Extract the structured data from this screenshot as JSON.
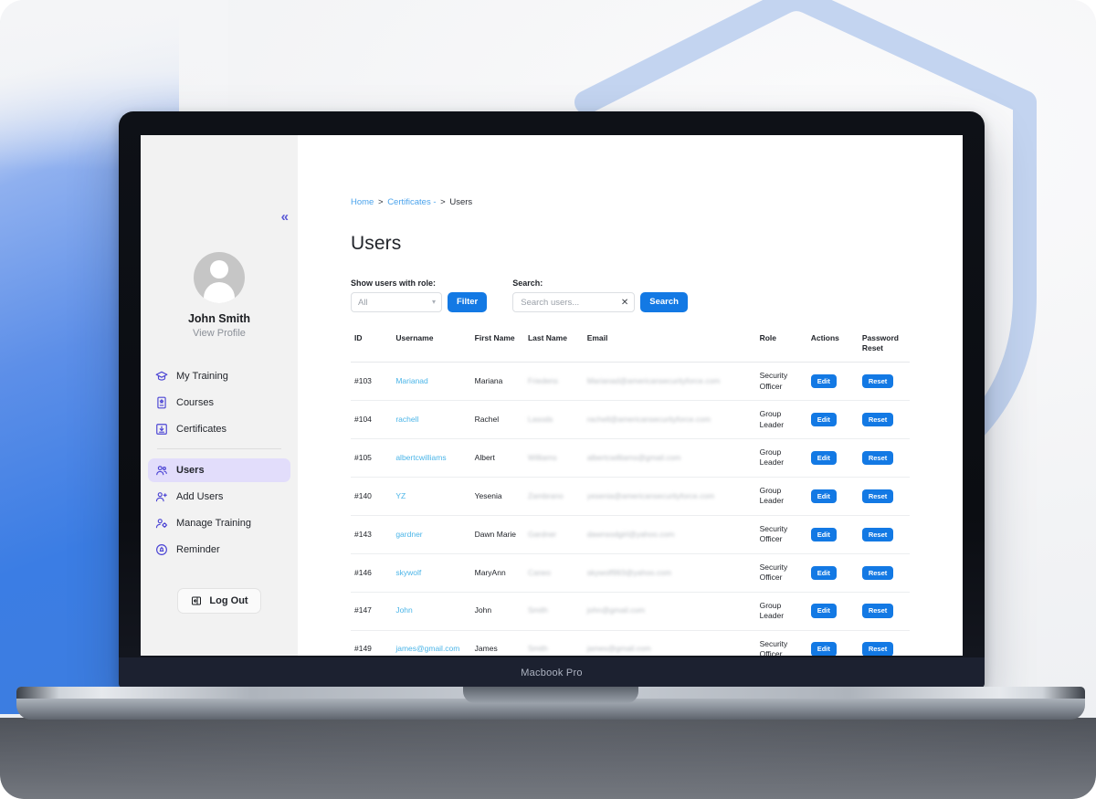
{
  "device": {
    "label": "Macbook Pro"
  },
  "sidebar": {
    "collapse_icon": "double-chevron-left",
    "profile": {
      "name": "John Smith",
      "link": "View Profile"
    },
    "items": [
      {
        "label": "My Training",
        "icon": "graduation-cap-icon",
        "active": false
      },
      {
        "label": "Courses",
        "icon": "course-card-icon",
        "active": false
      },
      {
        "label": "Certificates",
        "icon": "certificate-download-icon",
        "active": false
      },
      {
        "label": "Users",
        "icon": "users-icon",
        "active": true
      },
      {
        "label": "Add Users",
        "icon": "user-plus-icon",
        "active": false
      },
      {
        "label": "Manage Training",
        "icon": "user-gear-icon",
        "active": false
      },
      {
        "label": "Reminder",
        "icon": "bell-badge-icon",
        "active": false
      }
    ],
    "logout": {
      "label": "Log Out",
      "icon": "logout-icon"
    }
  },
  "breadcrumb": {
    "home": "Home",
    "sep1": ">",
    "certificates": "Certificates -",
    "sep2": ">",
    "current": "Users"
  },
  "page": {
    "title": "Users"
  },
  "controls": {
    "role_label": "Show users with role:",
    "role_value": "All",
    "filter_button": "Filter",
    "search_label": "Search:",
    "search_placeholder": "Search users...",
    "search_value": "",
    "search_clear_icon": "close-icon",
    "search_button": "Search"
  },
  "table": {
    "columns": [
      "ID",
      "Username",
      "First Name",
      "Last Name",
      "Email",
      "Role",
      "Actions",
      "Password Reset"
    ],
    "edit_label": "Edit",
    "reset_label": "Reset",
    "rows": [
      {
        "id": "#103",
        "username": "Marianad",
        "first": "Mariana",
        "last": "Friedens",
        "email": "Marianad@americansecurityforce.com",
        "role": "Security Officer"
      },
      {
        "id": "#104",
        "username": "rachell",
        "first": "Rachel",
        "last": "Lasods",
        "email": "rachell@americansecurityforce.com",
        "role": "Group Leader"
      },
      {
        "id": "#105",
        "username": "albertcwilliams",
        "first": "Albert",
        "last": "Williams",
        "email": "albertcwilliams@gmail.com",
        "role": "Group Leader"
      },
      {
        "id": "#140",
        "username": "YZ",
        "first": "Yesenia",
        "last": "Zambrano",
        "email": "yesenia@americansecurityforce.com",
        "role": "Group Leader"
      },
      {
        "id": "#143",
        "username": "gardner",
        "first": "Dawn Marie",
        "last": "Gardner",
        "email": "dawnsodgirl@yahoo.com",
        "role": "Security Officer"
      },
      {
        "id": "#146",
        "username": "skywolf",
        "first": "MaryAnn",
        "last": "Caneo",
        "email": "skywolf993@yahoo.com",
        "role": "Security Officer"
      },
      {
        "id": "#147",
        "username": "John",
        "first": "John",
        "last": "Smith",
        "email": "john@gmail.com",
        "role": "Group Leader"
      },
      {
        "id": "#149",
        "username": "james@gmail.com",
        "first": "James",
        "last": "Smith",
        "email": "james@gmail.com",
        "role": "Security Officer"
      }
    ]
  },
  "scrollbar": {
    "left_icon": "triangle-left-icon",
    "right_icon": "triangle-right-icon"
  },
  "colors": {
    "primary_blue": "#1379e4",
    "link_blue": "#4bb5e8",
    "breadcrumb_blue": "#4ba3ec",
    "sidebar_accent": "#4b44d4",
    "sidebar_active_bg": "#e2ddfb",
    "shield_decoration": "#c3d4f0",
    "background_blue": "#3d7ddf"
  }
}
